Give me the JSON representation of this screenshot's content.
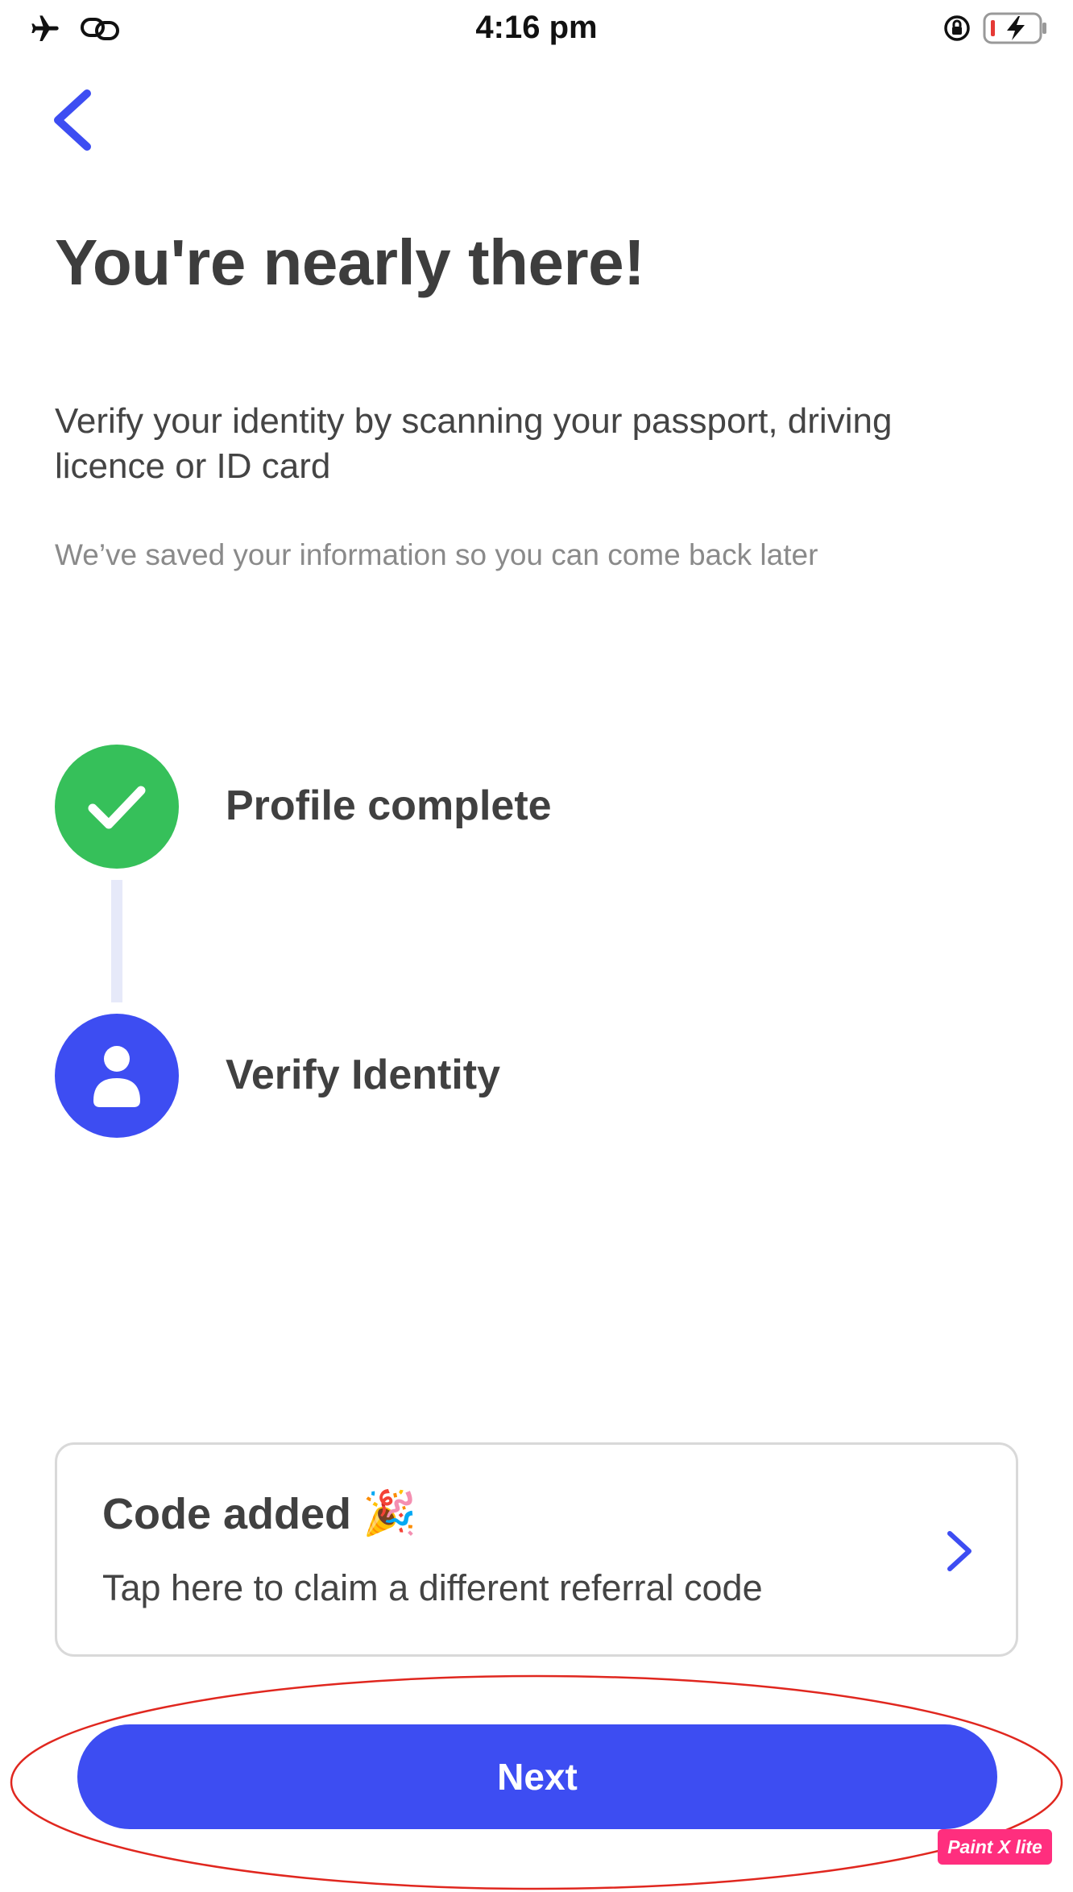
{
  "status_bar": {
    "time": "4:16 pm",
    "icons": [
      "airplane-mode-icon",
      "link-icon",
      "orientation-lock-icon",
      "battery-charging-icon"
    ]
  },
  "header": {
    "title": "You're nearly there!",
    "subtitle": "Verify your identity by scanning your passport, driving licence or ID card",
    "note": "We’ve saved your information so you can come back later"
  },
  "steps": [
    {
      "label": "Profile complete",
      "icon": "checkmark-icon",
      "color": "#36c05a",
      "status": "complete"
    },
    {
      "label": "Verify Identity",
      "icon": "person-icon",
      "color": "#3d4df2",
      "status": "current"
    }
  ],
  "referral_card": {
    "title": "Code added",
    "emoji": "🎉",
    "description": "Tap here to claim a different referral code"
  },
  "next_button": {
    "label": "Next"
  },
  "watermark": {
    "text": "Paint X lite"
  },
  "colors": {
    "accent": "#3d4df2",
    "success": "#36c05a",
    "annotation": "#e0271f"
  }
}
